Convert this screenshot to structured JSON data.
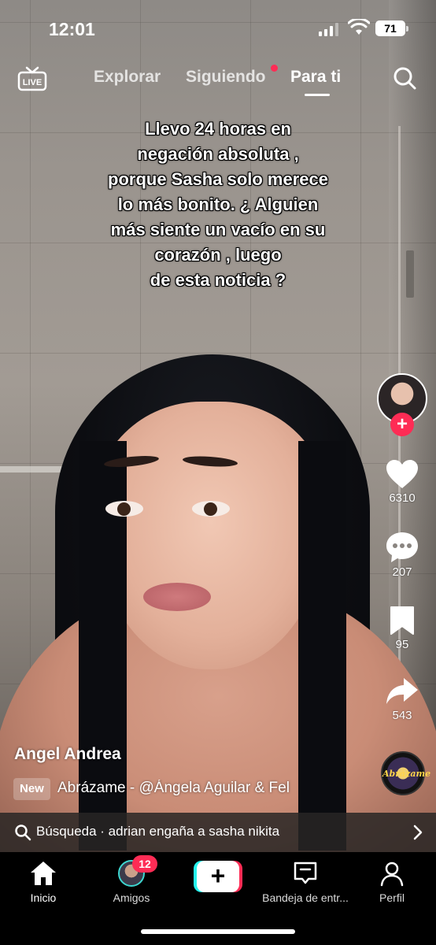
{
  "status_bar": {
    "time": "12:01",
    "battery": "71"
  },
  "top_nav": {
    "live_label": "LIVE",
    "tabs": [
      {
        "label": "Explorar"
      },
      {
        "label": "Siguiendo"
      },
      {
        "label": "Para ti"
      }
    ],
    "active_tab": "Para ti"
  },
  "video": {
    "caption": "Llevo 24 horas en\nnegación absoluta ,\nporque Sasha solo merece\nlo más bonito.  ¿ Alguien\nmás siente un vacío en su\ncorazón , luego\nde esta noticia ?"
  },
  "actions": {
    "likes": "6310",
    "comments": "207",
    "saves": "95",
    "shares": "543"
  },
  "post": {
    "author": "Angel Andrea",
    "new_badge": "New",
    "music": "Abrázame - @Ángela Aguilar & Fel",
    "disc_label": "Abrázame"
  },
  "search_suggestion": {
    "text": "Búsqueda · adrian engaña a sasha nikita"
  },
  "tab_bar": {
    "inicio": "Inicio",
    "amigos": "Amigos",
    "amigos_badge": "12",
    "create_symbol": "+",
    "bandeja": "Bandeja de entr...",
    "perfil": "Perfil"
  },
  "colors": {
    "accent": "#fe2c55",
    "accent_cyan": "#25f4ee"
  }
}
